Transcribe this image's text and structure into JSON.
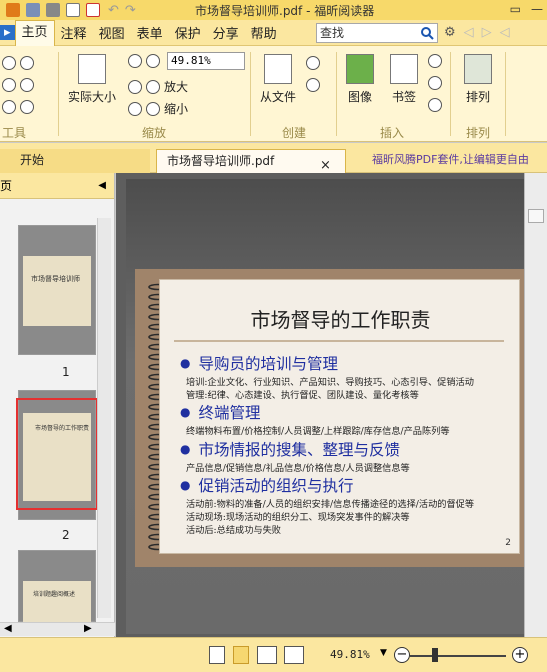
{
  "titlebar": {
    "title": "市场督导培训师.pdf - 福昕阅读器"
  },
  "menu": {
    "items": [
      "主页",
      "注释",
      "视图",
      "表单",
      "保护",
      "分享",
      "帮助"
    ],
    "search_value": "查找"
  },
  "ribbon": {
    "actual_size": "实际大小",
    "zoom_value": "49.81%",
    "zoom_in": "放大",
    "zoom_out": "缩小",
    "from_file": "从文件",
    "image": "图像",
    "bookmark": "书签",
    "arrange": "排列",
    "groups": {
      "tools": "工具",
      "zoom": "缩放",
      "create": "创建",
      "insert": "插入",
      "arrange": "排列"
    }
  },
  "tabs": {
    "start": "开始",
    "doc": "市场督导培训师.pdf",
    "promo": "福昕风腾PDF套件,让编辑更自由"
  },
  "left_panel": {
    "header": "页",
    "thumbs": [
      {
        "title": "市场督导培训师",
        "num": "1"
      },
      {
        "title": "市场督导的工作职责",
        "num": "2"
      },
      {
        "title": "培训题趣阅概述",
        "num": ""
      }
    ]
  },
  "slide": {
    "title": "市场督导的工作职责",
    "sections": [
      {
        "heading": "导购员的培训与管理",
        "lines": [
          "培训:企业文化、行业知识、产品知识、导购技巧、心态引导、促销活动",
          "管理:纪律、心态建设、执行督促、团队建设、量化考核等"
        ]
      },
      {
        "heading": "终端管理",
        "lines": [
          "终端物料布置/价格控制/人员调整/上样跟踪/库存信息/产品陈列等"
        ]
      },
      {
        "heading": "市场情报的搜集、整理与反馈",
        "lines": [
          "产品信息/促销信息/礼品信息/价格信息/人员调整信息等"
        ]
      },
      {
        "heading": "促销活动的组织与执行",
        "lines": [
          "活动前:物料的准备/人员的组织安排/信息传播途径的选择/活动的督促等",
          "活动现场:现场活动的组织分工、现场突发事件的解决等",
          "活动后:总结成功与失败"
        ]
      }
    ],
    "page_num": "2"
  },
  "status": {
    "zoom": "49.81%"
  }
}
